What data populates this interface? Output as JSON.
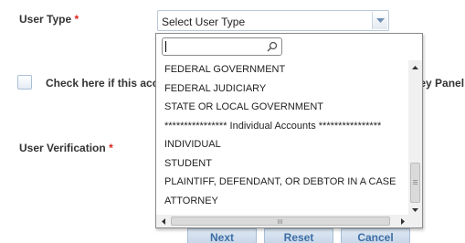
{
  "form": {
    "user_type_label": "User Type",
    "user_verification_label": "User Verification",
    "required_mark": "*",
    "checkbox_text_visible": "Check here if this acco",
    "right_text_visible": "ney Panel"
  },
  "select": {
    "selected_text": "Select User Type",
    "search_value": "",
    "options": [
      "FEDERAL GOVERNMENT",
      "FEDERAL JUDICIARY",
      "STATE OR LOCAL GOVERNMENT",
      "**************** Individual Accounts ****************",
      "INDIVIDUAL",
      "STUDENT",
      "PLAINTIFF, DEFENDANT, OR DEBTOR IN A CASE",
      "ATTORNEY"
    ]
  },
  "buttons": {
    "next": "Next",
    "reset": "Reset",
    "cancel": "Cancel"
  },
  "colors": {
    "required": "#d9251c",
    "button_text": "#3d6ea5"
  },
  "icons": [
    "search-icon",
    "dropdown-arrow-icon",
    "scroll-up-icon",
    "scroll-down-icon",
    "scroll-left-icon",
    "scroll-right-icon"
  ]
}
